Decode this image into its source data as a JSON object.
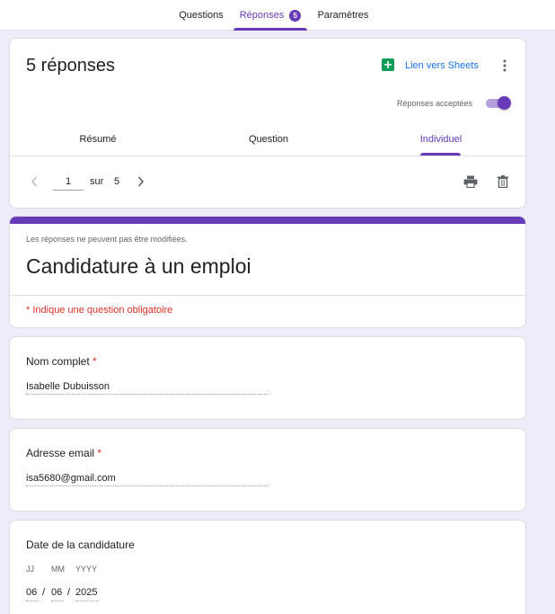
{
  "tabs": [
    {
      "label": "Questions"
    },
    {
      "label": "Réponses",
      "badge": "5",
      "active": true
    },
    {
      "label": "Paramètres"
    }
  ],
  "summary": {
    "title": "5 réponses",
    "sheets_link": "Lien vers Sheets",
    "accepting_label": "Réponses acceptées",
    "accepting": true,
    "subtabs": [
      {
        "label": "Résumé"
      },
      {
        "label": "Question"
      },
      {
        "label": "Individuel",
        "active": true
      }
    ],
    "pager": {
      "current": "1",
      "of_label": "sur",
      "total": "5"
    }
  },
  "form": {
    "readonly_note": "Les réponses ne peuvent pas être modifiées.",
    "title": "Candidature à un emploi",
    "required_note": "* Indique une question obligatoire"
  },
  "questions": {
    "name": {
      "label": "Nom complet",
      "required_mark": "*",
      "answer": "Isabelle Dubuisson"
    },
    "email": {
      "label": "Adresse email",
      "required_mark": "*",
      "answer": "isa5680@gmail.com"
    },
    "date": {
      "label": "Date de la candidature",
      "dd_label": "JJ",
      "mm_label": "MM",
      "yyyy_label": "YYYY",
      "dd": "06",
      "mm": "06",
      "yyyy": "2025",
      "sep": "/"
    }
  },
  "colors": {
    "accent": "#673ab7",
    "background": "#f0ebf8",
    "link": "#1a73e8",
    "required": "#d93025",
    "sheets_green": "#0f9d58"
  }
}
